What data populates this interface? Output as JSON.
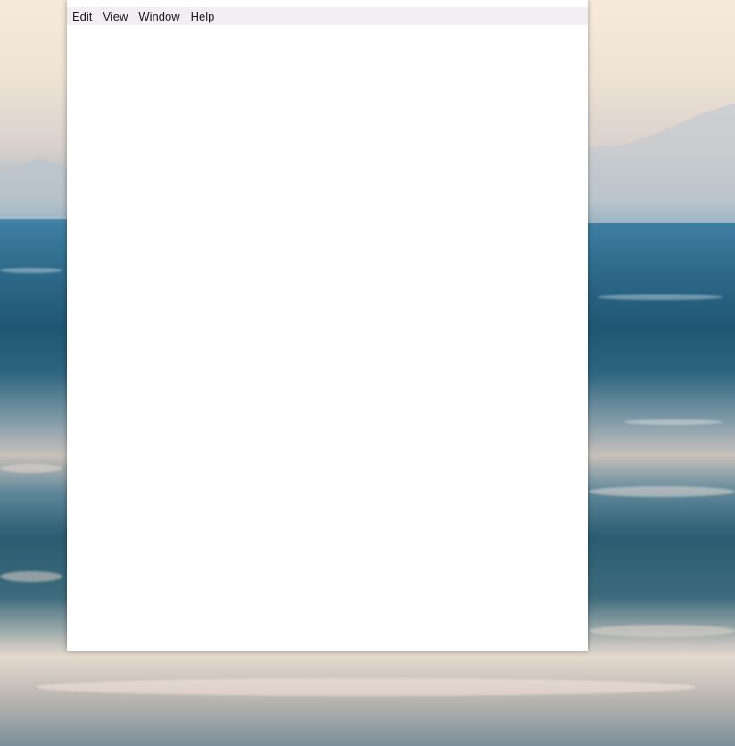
{
  "menubar": {
    "items": [
      {
        "label": "Edit"
      },
      {
        "label": "View"
      },
      {
        "label": "Window"
      },
      {
        "label": "Help"
      }
    ]
  },
  "colors": {
    "menubar_bg": "#f1eff1",
    "window_bg": "#ffffff",
    "sea": "#2e6b8b",
    "sky": "#f6eadb"
  }
}
